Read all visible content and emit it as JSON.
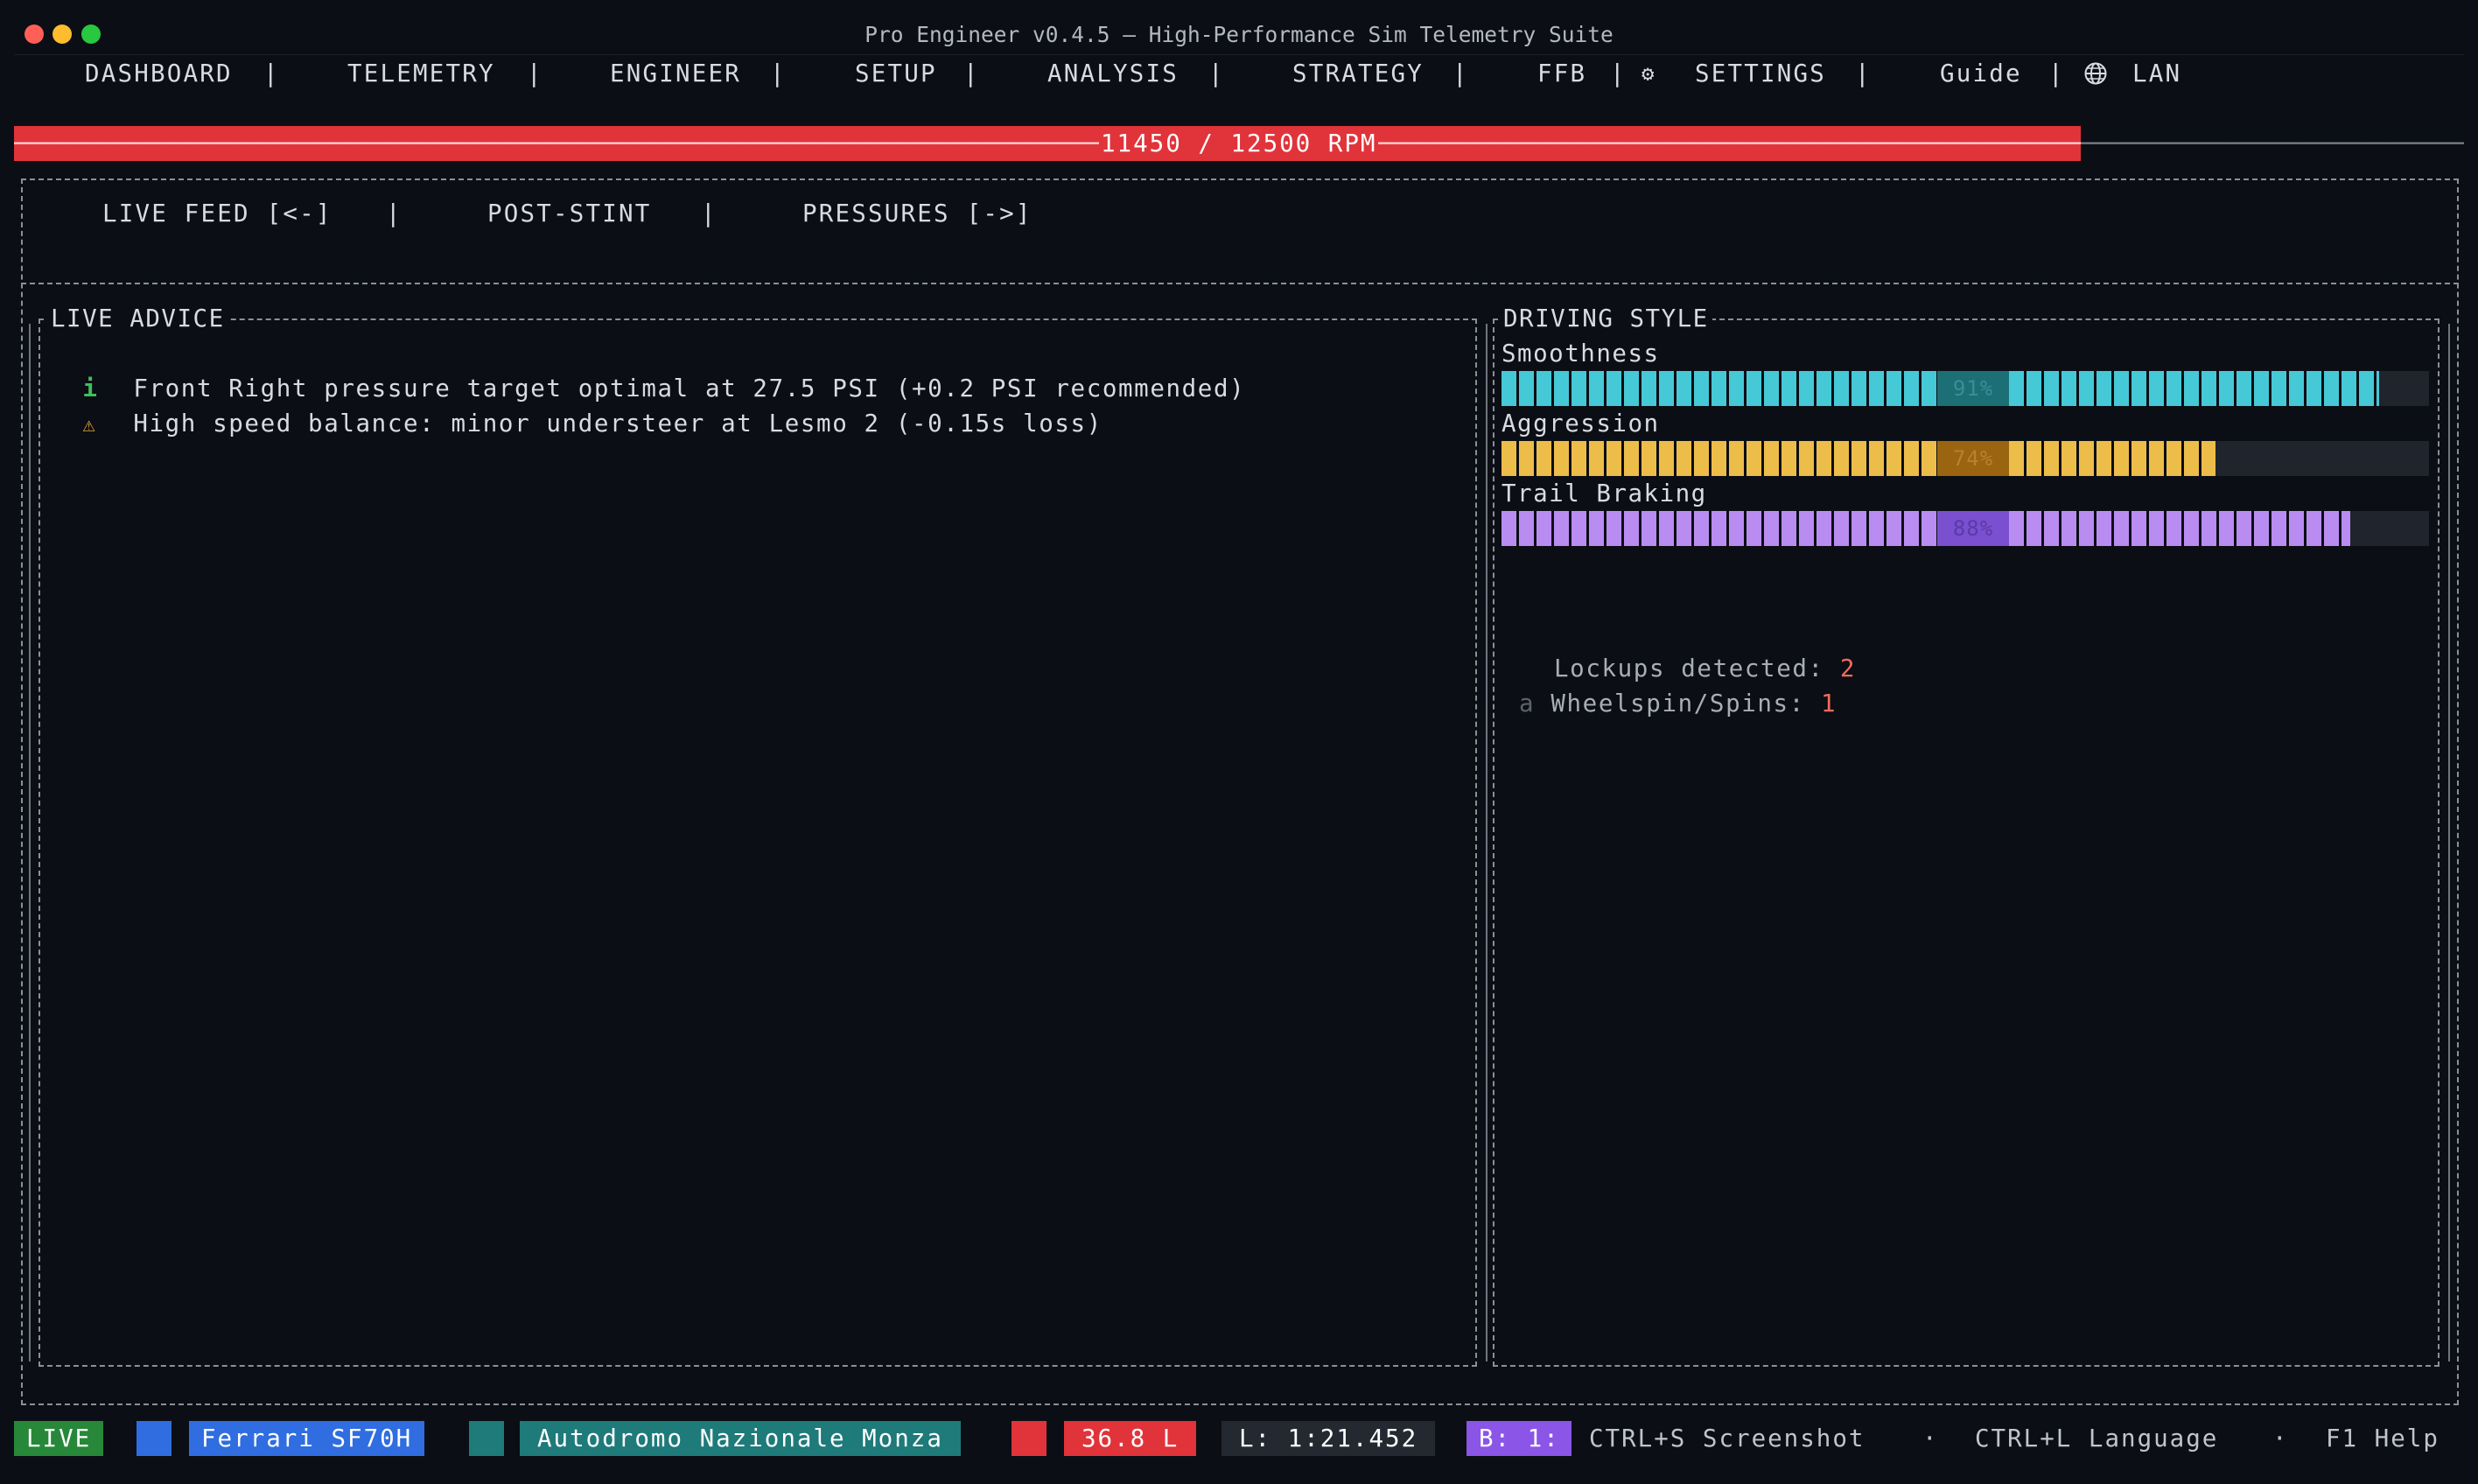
{
  "window": {
    "title": "Pro Engineer v0.4.5 — High-Performance Sim Telemetry Suite"
  },
  "menu": {
    "dashboard": "DASHBOARD",
    "telemetry": "TELEMETRY",
    "engineer": "ENGINEER",
    "setup": "SETUP",
    "analysis": "ANALYSIS",
    "strategy": "STRATEGY",
    "ffb": "FFB",
    "settings": "SETTINGS",
    "guide": "Guide",
    "lan": "LAN",
    "separator": "|",
    "gear_glyph": "⚙"
  },
  "rpm": {
    "label": "11450 / 12500 RPM",
    "current": 11450,
    "max": 12500,
    "color": "#e0343a"
  },
  "subtabs": {
    "live_feed": "LIVE FEED [<-]",
    "post_stint": "POST-STINT",
    "pressures": "PRESSURES [->]",
    "separator": "|"
  },
  "live_advice": {
    "title": "LIVE ADVICE",
    "items": [
      {
        "icon": "i",
        "icon_name": "info-icon",
        "color": "#3fbf5a",
        "text": "Front Right pressure target optimal at 27.5 PSI (+0.2 PSI recommended)"
      },
      {
        "icon": "⚠",
        "icon_name": "warning-icon",
        "color": "#e0a63a",
        "text": "High speed balance: minor understeer at Lesmo 2 (-0.15s loss)"
      }
    ]
  },
  "driving_style": {
    "title": "DRIVING STYLE",
    "metrics": [
      {
        "label": "Smoothness",
        "percent": 91,
        "pct_text": "91%",
        "color": "#46c9d6",
        "pct_bg": "#1d6f76",
        "pct_fg": "#3c8d94"
      },
      {
        "label": "Aggression",
        "percent": 74,
        "pct_text": "74%",
        "color": "#edbd4a",
        "pct_bg": "#9a6410",
        "pct_fg": "#b78230"
      },
      {
        "label": "Trail Braking",
        "percent": 88,
        "pct_text": "88%",
        "color": "#b98cf2",
        "pct_bg": "#7a4fd0",
        "pct_fg": "#5a3aa8"
      }
    ],
    "stats": {
      "lockups_label": "Lockups detected:",
      "lockups_value": "2",
      "wheelspin_prefix": "a",
      "wheelspin_label": "Wheelspin/Spins:",
      "wheelspin_value": "1"
    }
  },
  "status_bar": {
    "live": "LIVE",
    "car": "Ferrari SF70H",
    "track": "Autodromo Nazionale Monza",
    "fuel": "36.8 L",
    "lap": "L: 1:21.452",
    "best": "B: 1:",
    "hint_screenshot": "CTRL+S Screenshot",
    "hint_language": "CTRL+L Language",
    "hint_help": "F1 Help",
    "hint_sep": "·",
    "colors": {
      "live": "#27883a",
      "car": "#2f6de0",
      "track": "#1f7a7a",
      "fuel": "#e0343a",
      "lap": "#232831",
      "best": "#8b55e8"
    }
  }
}
